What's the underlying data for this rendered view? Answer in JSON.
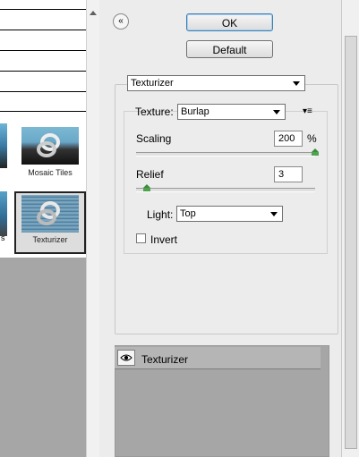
{
  "buttons": {
    "ok": "OK",
    "default": "Default",
    "collapse": "«"
  },
  "filter": {
    "selected": "Texturizer"
  },
  "texture": {
    "label": "Texture:",
    "selected": "Burlap",
    "menu_icon": "▾≡"
  },
  "scaling": {
    "label": "Scaling",
    "value": "200",
    "unit": "%",
    "level": 1.0
  },
  "relief": {
    "label": "Relief",
    "value": "3",
    "level": 0.06
  },
  "light": {
    "label": "Light:",
    "selected": "Top"
  },
  "invert": {
    "label": "Invert",
    "checked": false
  },
  "gallery": {
    "thumbs": [
      {
        "caption": "Mosaic Tiles"
      },
      {
        "caption": "Texturizer"
      }
    ],
    "left_partial_caption": "s"
  },
  "layers": [
    {
      "name": "Texturizer",
      "visible": true
    }
  ],
  "icons": {
    "eye": "eye-icon",
    "collapse": "double-chevron-up-icon",
    "menu": "panel-menu-icon"
  },
  "colors": {
    "accent": "#3c7fb1",
    "knob": "#4fa34f",
    "gallery_bg": "#a6a6a6"
  }
}
